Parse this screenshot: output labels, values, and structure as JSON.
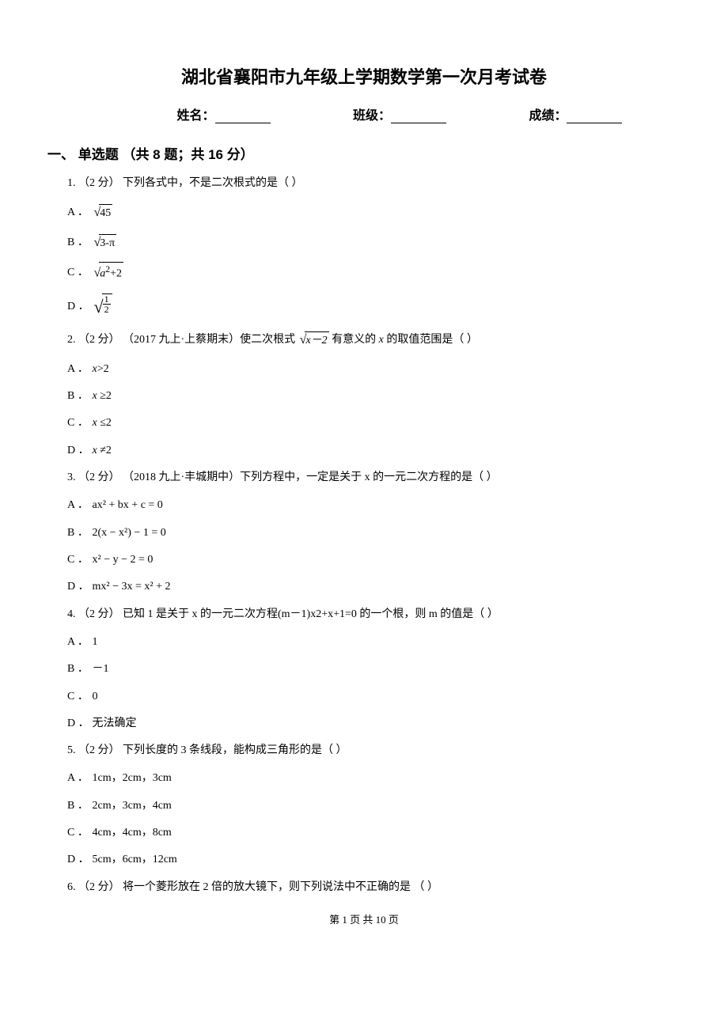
{
  "title": "湖北省襄阳市九年级上学期数学第一次月考试卷",
  "info": {
    "name_label": "姓名：",
    "class_label": "班级：",
    "score_label": "成绩："
  },
  "section1": {
    "header": "一、 单选题 （共 8 题；共 16 分）",
    "q1": {
      "stem_prefix": "1. （2 分） 下列各式中，不是二次根式的是（    ）",
      "a_letter": "A ．",
      "a_val": "45",
      "b_letter": "B ．",
      "b_val": "3-π",
      "c_letter": "C ．",
      "c_val_a": "a",
      "c_val_sup": "2",
      "c_val_tail": "+2",
      "d_letter": "D ．",
      "d_num": "1",
      "d_den": "2"
    },
    "q2": {
      "stem_a": "2. （2 分） （2017 九上·上蔡期末）使二次根式 ",
      "stem_sqrt": "x－2",
      "stem_b": " 有意义的 ",
      "stem_x": "x",
      "stem_c": " 的取值范围是（    ）",
      "a_letter": "A ．",
      "a_text_x": "x",
      "a_text_tail": ">2",
      "b_letter": "B ．",
      "b_text_x": "x",
      "b_text_tail": " ≥2",
      "c_letter": "C ．",
      "c_text_x": "x",
      "c_text_tail": " ≤2",
      "d_letter": "D ．",
      "d_text_x": "x",
      "d_text_tail": " ≠2"
    },
    "q3": {
      "stem": "3. （2 分） （2018 九上·丰城期中）下列方程中，一定是关于 x 的一元二次方程的是（    ）",
      "a_letter": "A ．",
      "a_text": "ax² + bx + c = 0",
      "b_letter": "B ．",
      "b_text": "2(x − x²) − 1 = 0",
      "c_letter": "C ．",
      "c_text": "x² − y − 2 = 0",
      "d_letter": "D ．",
      "d_text": "mx² − 3x = x² + 2"
    },
    "q4": {
      "stem": "4. （2 分） 已知 1 是关于 x 的一元二次方程(m－1)x2+x+1=0 的一个根，则 m 的值是（    ）",
      "a_letter": "A ．",
      "a_text": "1",
      "b_letter": "B ．",
      "b_text": "－1",
      "c_letter": "C ．",
      "c_text": "0",
      "d_letter": "D ．",
      "d_text": "无法确定"
    },
    "q5": {
      "stem": "5. （2 分） 下列长度的 3 条线段，能构成三角形的是（    ）",
      "a_letter": "A ．",
      "a_text": "1cm，2cm，3cm",
      "b_letter": "B ．",
      "b_text": "2cm，3cm，4cm",
      "c_letter": "C ．",
      "c_text": "4cm，4cm，8cm",
      "d_letter": "D ．",
      "d_text": "5cm，6cm，12cm"
    },
    "q6": {
      "stem": "6. （2 分） 将一个菱形放在 2 倍的放大镜下，则下列说法中不正确的是 （    ）"
    }
  },
  "footer": "第 1 页 共 10 页"
}
